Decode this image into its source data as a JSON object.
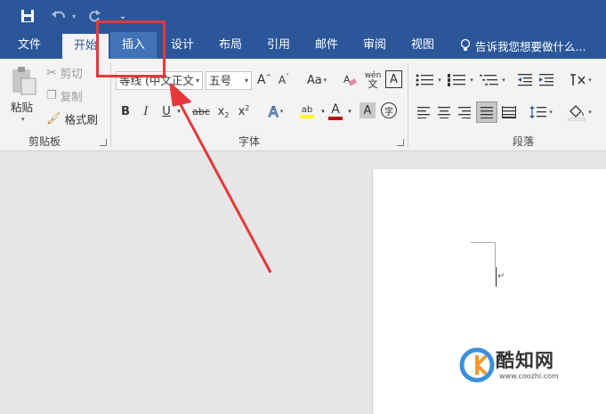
{
  "qat": {
    "save_icon": "save-icon",
    "undo_icon": "undo-icon",
    "redo_icon": "redo-icon",
    "customize_icon": "customize-qat-icon"
  },
  "tabs": [
    {
      "label": "文件"
    },
    {
      "label": "开始"
    },
    {
      "label": "插入"
    },
    {
      "label": "设计"
    },
    {
      "label": "布局"
    },
    {
      "label": "引用"
    },
    {
      "label": "邮件"
    },
    {
      "label": "审阅"
    },
    {
      "label": "视图"
    }
  ],
  "tell_me": {
    "text": "告诉我您想要做什么..."
  },
  "clipboard": {
    "paste": "粘贴",
    "cut": "剪切",
    "copy": "复制",
    "format_painter": "格式刷",
    "group_label": "剪贴板"
  },
  "font": {
    "font_name": "等线 (中文正文",
    "font_size": "五号",
    "grow": "A",
    "shrink": "A",
    "case": "Aa",
    "phonetic": "wén",
    "border_char": "A",
    "bold": "B",
    "italic": "I",
    "underline": "U",
    "strike": "abc",
    "subscript": "x",
    "superscript": "x",
    "text_effect": "A",
    "highlight": "ab",
    "font_color": "A",
    "shading": "A",
    "enclose": "字",
    "group_label": "字体"
  },
  "paragraph": {
    "group_label": "段落"
  },
  "watermark": {
    "brand": "酷知网",
    "url": "www.coozhi.com"
  },
  "colors": {
    "accent": "#2b579a",
    "highlight_red": "#e5383b",
    "font_color_red": "#c00000",
    "highlight_yellow": "#ffff00"
  }
}
